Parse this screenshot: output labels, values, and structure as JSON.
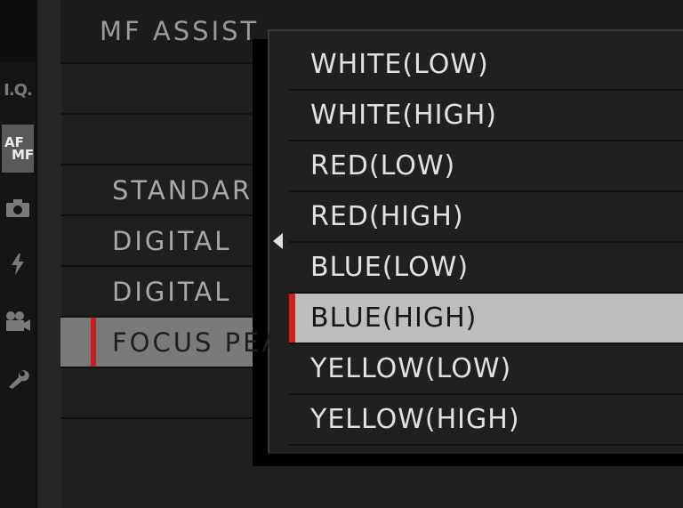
{
  "colors": {
    "accent": "#c72020",
    "selected_bg": "#bdbdbd",
    "panel_bg": "#202020"
  },
  "sidebar": {
    "tabs": [
      {
        "label": "I.Q.",
        "icon": "image-quality-icon",
        "active": false
      },
      {
        "label_top": "AF",
        "label_bottom": "MF",
        "icon": "af-mf-icon",
        "active": true
      },
      {
        "icon": "camera-icon",
        "active": false
      },
      {
        "icon": "flash-icon",
        "active": false
      },
      {
        "icon": "movie-camera-icon",
        "active": false
      },
      {
        "icon": "wrench-icon",
        "active": false
      }
    ]
  },
  "background_menu": {
    "title": "MF ASSIST",
    "items": [
      "STANDAR",
      "DIGITAL",
      "DIGITAL",
      "FOCUS PEA"
    ],
    "selected_index": 3
  },
  "popup": {
    "options": [
      "WHITE(LOW)",
      "WHITE(HIGH)",
      "RED(LOW)",
      "RED(HIGH)",
      "BLUE(LOW)",
      "BLUE(HIGH)",
      "YELLOW(LOW)",
      "YELLOW(HIGH)"
    ],
    "selected_index": 5
  }
}
